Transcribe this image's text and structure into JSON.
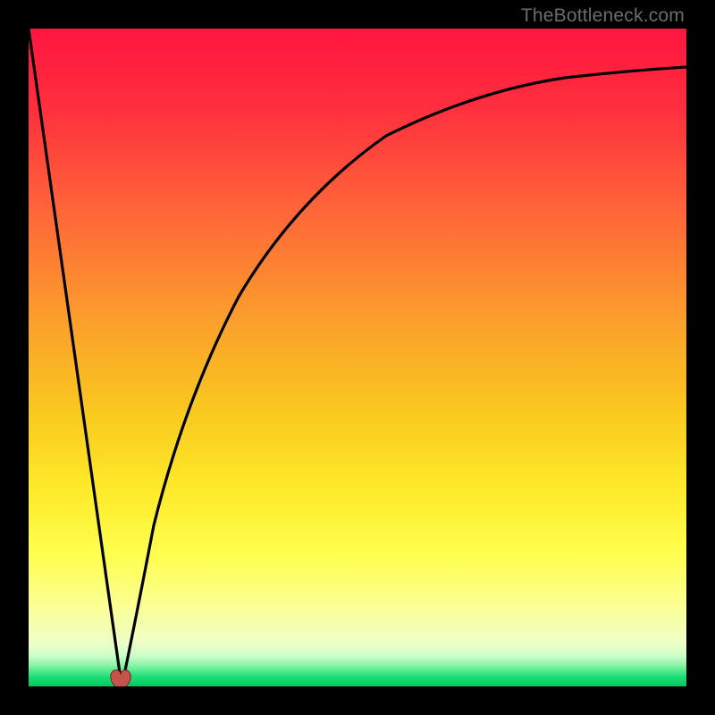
{
  "watermark": "TheBottleneck.com",
  "colors": {
    "black": "#000000",
    "line": "#000000",
    "marker_fill": "#c6544b",
    "marker_outline": "#741d1d",
    "grad_top": "#ff153f",
    "grad_upper_mid": "#ff6f3a",
    "grad_mid": "#fcd41a",
    "grad_lower_mid": "#fff66b",
    "grad_pale": "#faffb5",
    "grad_bottom_green": "#00e36b",
    "grad_bottom_green2": "#00c85f"
  },
  "chart_data": {
    "type": "line",
    "title": "",
    "xlabel": "",
    "ylabel": "",
    "xlim": [
      0,
      100
    ],
    "ylim": [
      0,
      100
    ],
    "grid": false,
    "legend": null,
    "minimum": {
      "x": 14,
      "y": 0
    },
    "marker": {
      "x_pct": 14,
      "y_pct": 99,
      "color": "#c6544b"
    },
    "series": [
      {
        "name": "left-branch",
        "x": [
          0,
          2,
          4,
          6,
          8,
          10,
          12,
          13,
          14
        ],
        "values": [
          100,
          86,
          71,
          56,
          42,
          28,
          14,
          7,
          0
        ]
      },
      {
        "name": "right-branch",
        "x": [
          14,
          15,
          17,
          20,
          24,
          30,
          38,
          48,
          60,
          72,
          84,
          100
        ],
        "values": [
          0,
          9,
          24,
          40,
          55,
          67,
          76,
          82,
          86,
          89,
          91,
          93
        ]
      }
    ],
    "annotations": [
      {
        "text": "TheBottleneck.com",
        "position": "top-right"
      }
    ]
  }
}
